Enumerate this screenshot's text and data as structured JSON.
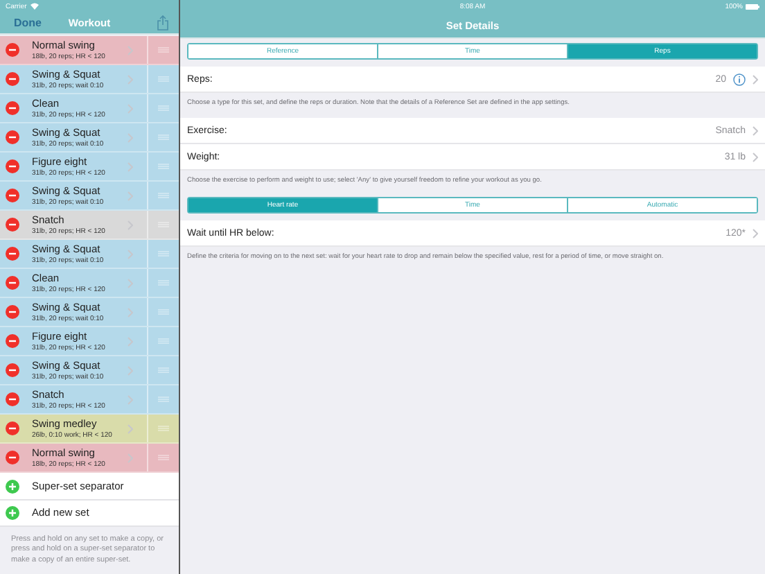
{
  "status_bar": {
    "carrier": "Carrier",
    "time": "8:08 AM",
    "battery": "100%"
  },
  "sidebar": {
    "nav": {
      "left_button": "Done",
      "title": "Workout"
    },
    "sets": [
      {
        "title": "Normal swing",
        "detail": "18lb, 20 reps; HR < 120",
        "color": "#e8b9bf"
      },
      {
        "title": "Swing & Squat",
        "detail": "31lb, 20 reps; wait 0:10",
        "color": "#b4d9ea"
      },
      {
        "title": "Clean",
        "detail": "31lb, 20 reps; HR < 120",
        "color": "#b4d9ea"
      },
      {
        "title": "Swing & Squat",
        "detail": "31lb, 20 reps; wait 0:10",
        "color": "#b4d9ea"
      },
      {
        "title": "Figure eight",
        "detail": "31lb, 20 reps; HR < 120",
        "color": "#b4d9ea"
      },
      {
        "title": "Swing & Squat",
        "detail": "31lb, 20 reps; wait 0:10",
        "color": "#b4d9ea"
      },
      {
        "title": "Snatch",
        "detail": "31lb, 20 reps; HR < 120",
        "color": "#d9d9d9"
      },
      {
        "title": "Swing & Squat",
        "detail": "31lb, 20 reps; wait 0:10",
        "color": "#b4d9ea"
      },
      {
        "title": "Clean",
        "detail": "31lb, 20 reps; HR < 120",
        "color": "#b4d9ea"
      },
      {
        "title": "Swing & Squat",
        "detail": "31lb, 20 reps; wait 0:10",
        "color": "#b4d9ea"
      },
      {
        "title": "Figure eight",
        "detail": "31lb, 20 reps; HR < 120",
        "color": "#b4d9ea"
      },
      {
        "title": "Swing & Squat",
        "detail": "31lb, 20 reps; wait 0:10",
        "color": "#b4d9ea"
      },
      {
        "title": "Snatch",
        "detail": "31lb, 20 reps; HR < 120",
        "color": "#b4d9ea"
      },
      {
        "title": "Swing medley",
        "detail": "26lb, 0:10 work; HR < 120",
        "color": "#d9dcaa"
      },
      {
        "title": "Normal swing",
        "detail": "18lb, 20 reps; HR < 120",
        "color": "#e8b9bf"
      }
    ],
    "actions": [
      "Super-set separator",
      "Add new set"
    ],
    "footer": "Press and hold on any set to make a copy, or press and hold on a super-set separator to make a copy of an entire super-set."
  },
  "detail": {
    "title": "Set Details",
    "sections": [
      {
        "segments": [
          {
            "label": "Reference",
            "selected": false
          },
          {
            "label": "Time",
            "selected": false
          },
          {
            "label": "Reps",
            "selected": true
          }
        ],
        "rows": [
          {
            "label": "Reps:",
            "value": "20",
            "info": true
          }
        ],
        "note": "Choose a type for this set, and define the reps or duration. Note that the details of a Reference Set are defined in the app settings."
      },
      {
        "rows": [
          {
            "label": "Exercise:",
            "value": "Snatch",
            "info": false
          },
          {
            "label": "Weight:",
            "value": "31 lb",
            "info": false
          }
        ],
        "note": "Choose the exercise to perform and weight to use; select 'Any' to give yourself freedom to refine your workout as you go."
      },
      {
        "segments": [
          {
            "label": "Heart rate",
            "selected": true
          },
          {
            "label": "Time",
            "selected": false
          },
          {
            "label": "Automatic",
            "selected": false
          }
        ],
        "rows": [
          {
            "label": "Wait until HR below:",
            "value": "120*",
            "info": false
          }
        ],
        "note": "Define the criteria for moving on to the next set: wait for your heart rate to drop and remain below the specified value, rest for a period of time, or move straight on."
      }
    ]
  }
}
